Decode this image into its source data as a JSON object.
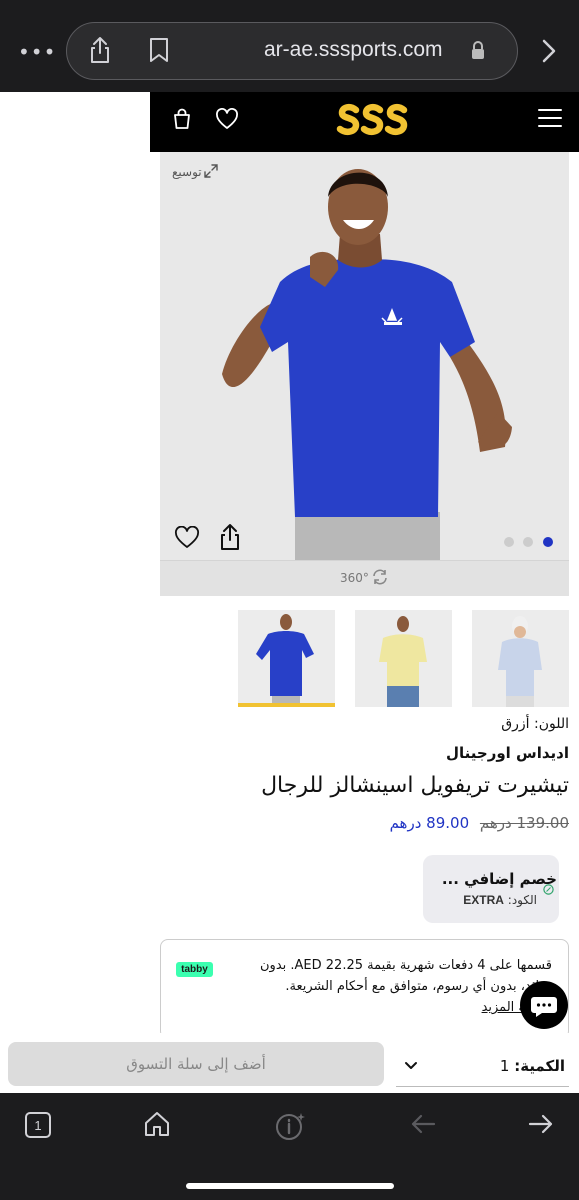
{
  "browser": {
    "url": "ar-ae.sssports.com",
    "more_icon": "ellipsis-icon",
    "tab_count": "1"
  },
  "header": {
    "logo": "SSS",
    "colors": {
      "background": "#000000",
      "logo": "#f1c232"
    }
  },
  "gallery": {
    "expand_label": "توسيع",
    "view360_label": "360°",
    "active_dot_color": "#2034c4",
    "thumb_selected_color": "#f1c232"
  },
  "product": {
    "color_line": "اللون: أزرق",
    "brand": "اديداس اورجينال",
    "title": "تيشيرت تريفويل اسينشالز للرجال",
    "old_price": "139.00 درهم",
    "new_price": "89.00 درهم",
    "shirt_color": "#2840c8"
  },
  "promo": {
    "title": "خصم إضافي ...",
    "code_label": "الكود:",
    "code_value": "EXTRA"
  },
  "tabby": {
    "logo": "tabby",
    "line1": "قسمها على 4 دفعات شهرية بقيمة AED 22.25. بدون",
    "line2": "فوائد، بدون أي رسوم، متوافق مع أحكام الشريعة.",
    "line3": "معرفة المزيد"
  },
  "actions": {
    "add_to_cart": "أضف إلى سلة التسوق",
    "qty_label": "الكمية:",
    "qty_value": "1"
  }
}
